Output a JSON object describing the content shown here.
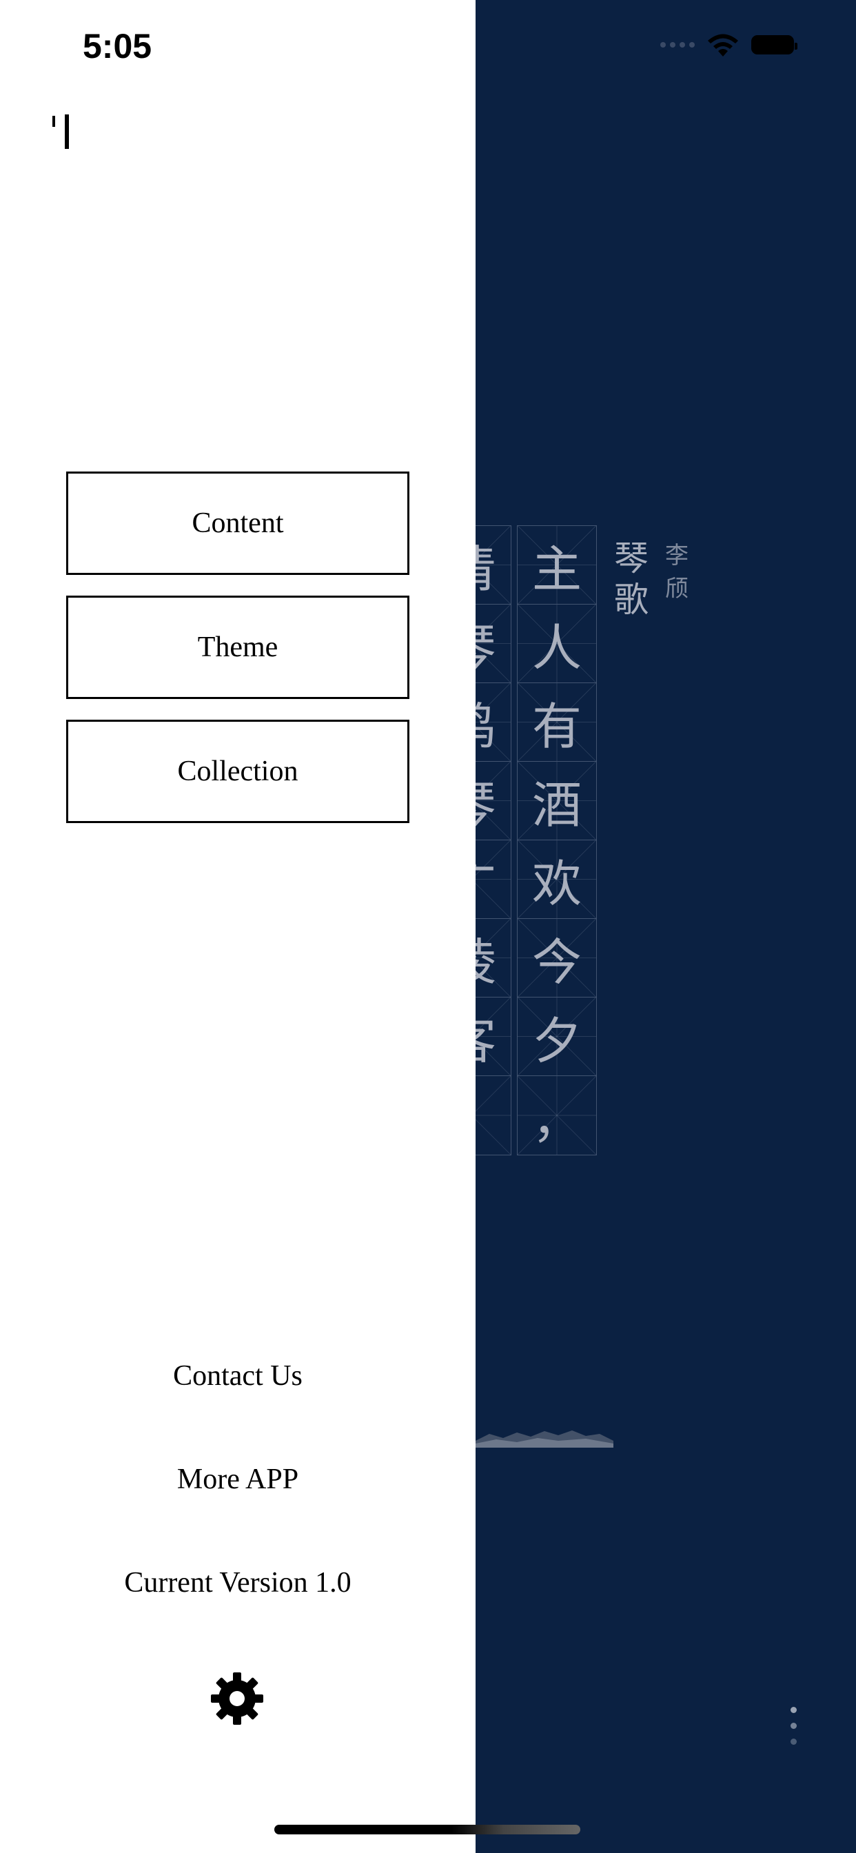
{
  "status_bar": {
    "time": "5:05"
  },
  "drawer": {
    "menu": [
      {
        "label": "Content"
      },
      {
        "label": "Theme"
      },
      {
        "label": "Collection"
      }
    ],
    "links": {
      "contact": "Contact Us",
      "more_app": "More APP"
    },
    "version_text": "Current Version 1.0",
    "settings_icon": "gear-icon"
  },
  "poem": {
    "title": "琴歌",
    "author": "李颀",
    "column1": [
      "主",
      "人",
      "有",
      "酒",
      "欢",
      "今",
      "夕",
      "，"
    ],
    "column2": [
      "清",
      "琴",
      "鸣",
      "琴",
      "广",
      "陵",
      "客",
      ""
    ]
  },
  "colors": {
    "background": "#0b2142",
    "drawer": "#ffffff"
  }
}
